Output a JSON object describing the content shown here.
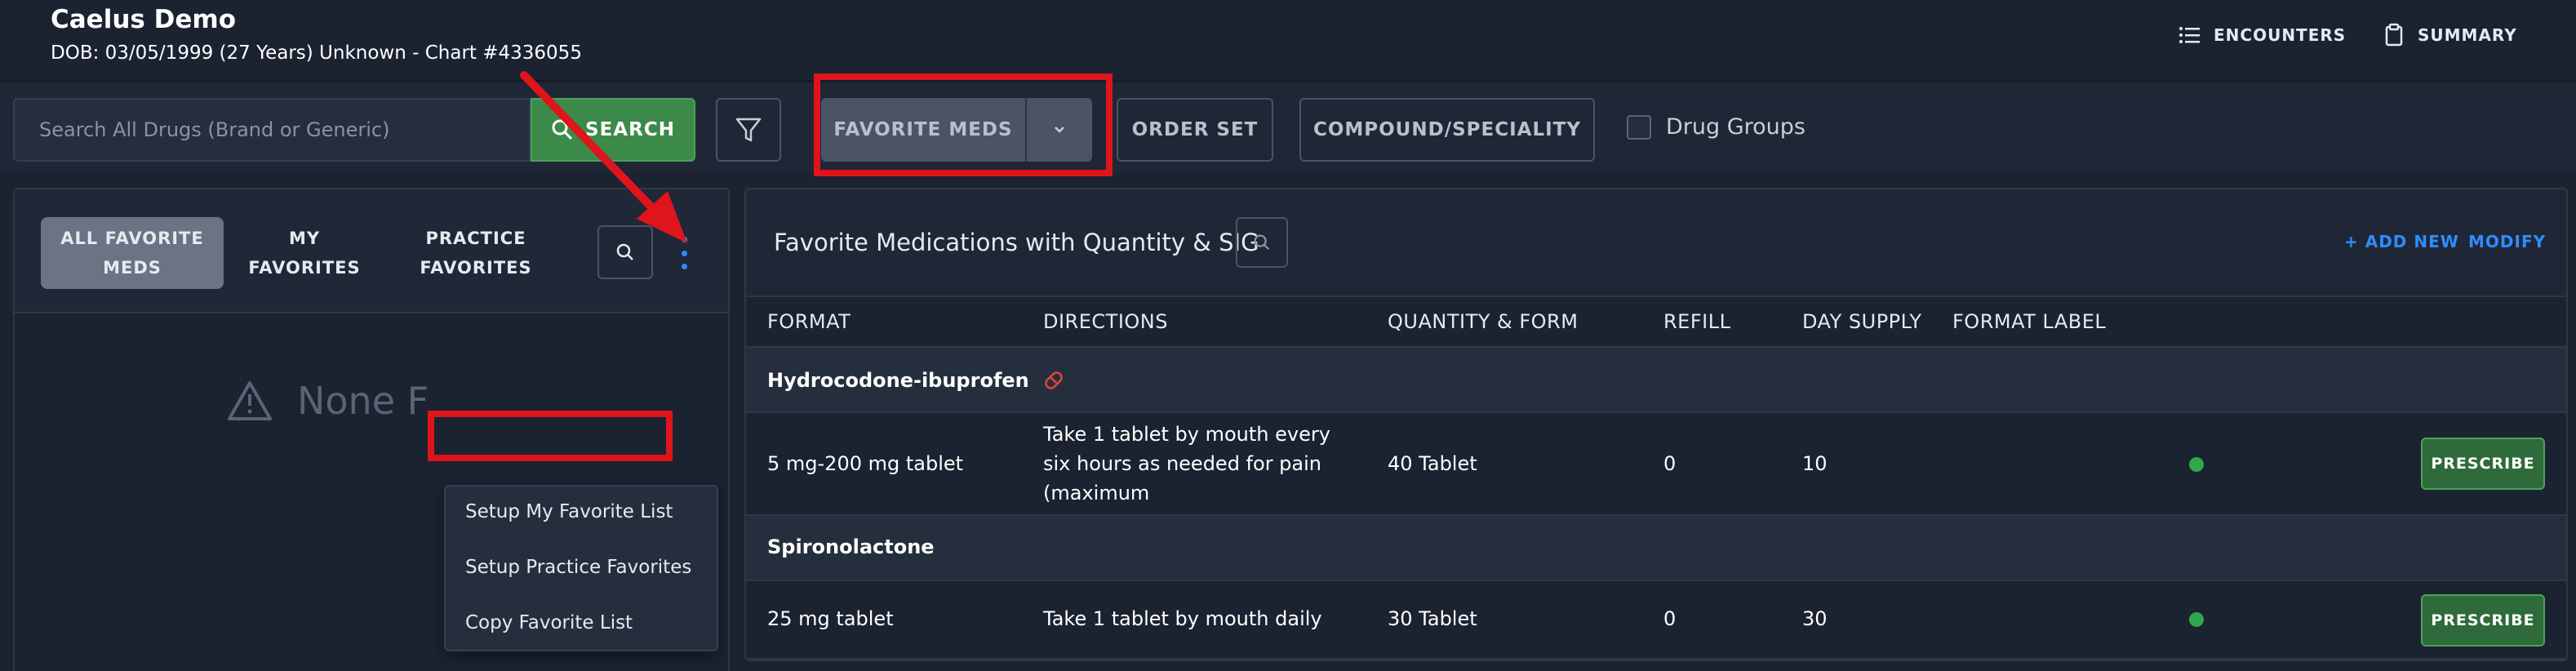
{
  "header": {
    "patient_name": "Caelus Demo",
    "patient_info": "DOB: 03/05/1999 (27 Years) Unknown - Chart #4336055",
    "encounters_label": "ENCOUNTERS",
    "summary_label": "SUMMARY"
  },
  "toolbar": {
    "search_placeholder": "Search All Drugs (Brand or Generic)",
    "search_label": "SEARCH",
    "favorite_meds_label": "FAVORITE MEDS",
    "order_set_label": "ORDER SET",
    "compound_label": "COMPOUND/SPECIALITY",
    "drug_groups_label": "Drug Groups"
  },
  "left_panel": {
    "tabs": [
      {
        "label": "ALL FAVORITE MEDS",
        "active": true
      },
      {
        "label": "MY FAVORITES",
        "active": false
      },
      {
        "label": "PRACTICE FAVORITES",
        "active": false
      }
    ],
    "empty_text": "None F",
    "menu_items": [
      "Setup My Favorite List",
      "Setup Practice Favorites",
      "Copy Favorite List"
    ]
  },
  "right_panel": {
    "title": "Favorite Medications with Quantity & SIG",
    "add_new_label": "+ ADD NEW",
    "modify_label": "MODIFY",
    "columns": [
      "FORMAT",
      "DIRECTIONS",
      "QUANTITY & FORM",
      "REFILL",
      "DAY SUPPLY",
      "FORMAT LABEL"
    ],
    "groups": [
      {
        "name": "Hydrocodone-ibuprofen",
        "controlled": true,
        "row": {
          "format": "5 mg-200 mg tablet",
          "directions": "Take 1 tablet by mouth every six hours as needed for pain (maximum",
          "quantity": "40 Tablet",
          "refill": "0",
          "day_supply": "10",
          "action": "PRESCRIBE"
        }
      },
      {
        "name": "Spironolactone",
        "controlled": false,
        "row": {
          "format": "25 mg tablet",
          "directions": "Take 1 tablet by mouth daily",
          "quantity": "30 Tablet",
          "refill": "0",
          "day_supply": "30",
          "action": "PRESCRIBE"
        }
      }
    ]
  },
  "colors": {
    "accent_blue": "#2f8cff",
    "search_green": "#3c8a4a",
    "status_green": "#2ea84a",
    "annotation_red": "#e0141b"
  }
}
